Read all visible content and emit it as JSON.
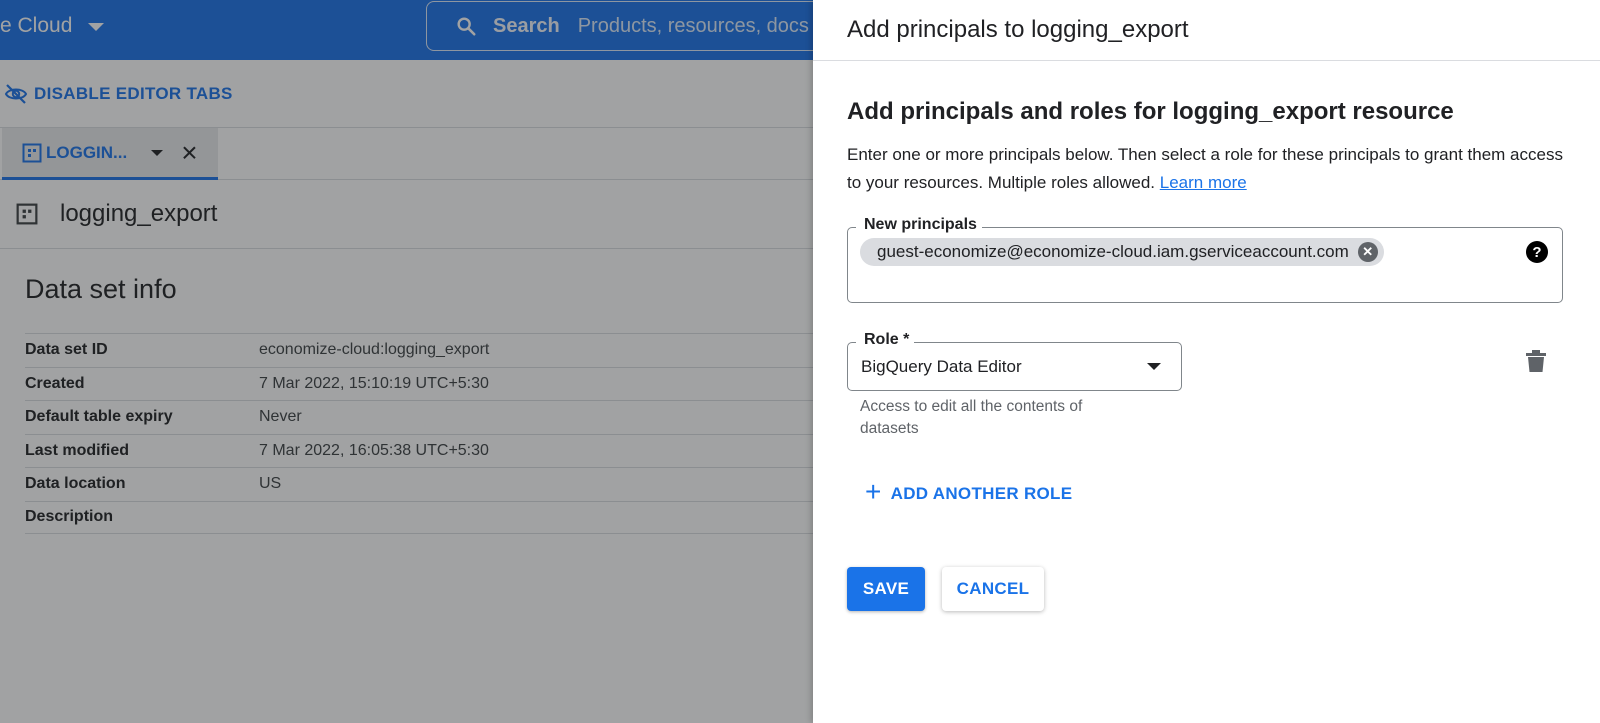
{
  "colors": {
    "brand_blue": "#1a73e8",
    "text": "#202124",
    "muted": "#5f6368"
  },
  "topbar": {
    "brand": "e Cloud",
    "search_label": "Search",
    "search_placeholder": "Products, resources, docs"
  },
  "toolbar": {
    "disable_tabs_label": "DISABLE EDITOR TABS"
  },
  "tab": {
    "label": "LOGGIN..."
  },
  "resource": {
    "title": "logging_export"
  },
  "dataset_info": {
    "title": "Data set info",
    "rows": [
      {
        "key": "Data set ID",
        "value": "economize-cloud:logging_export"
      },
      {
        "key": "Created",
        "value": "7 Mar 2022, 15:10:19 UTC+5:30"
      },
      {
        "key": "Default table expiry",
        "value": "Never"
      },
      {
        "key": "Last modified",
        "value": "7 Mar 2022, 16:05:38 UTC+5:30"
      },
      {
        "key": "Data location",
        "value": "US"
      },
      {
        "key": "Description",
        "value": ""
      }
    ]
  },
  "panel": {
    "title": "Add principals to logging_export",
    "section_title": "Add principals and roles for logging_export resource",
    "description": "Enter one or more principals below. Then select a role for these principals to grant them access to your resources. Multiple roles allowed.",
    "learn_more": "Learn more",
    "principals_label": "New principals",
    "principal_chip": "guest-economize@economize-cloud.iam.gserviceaccount.com",
    "help_glyph": "?",
    "role_label": "Role *",
    "role_value": "BigQuery Data Editor",
    "role_hint": "Access to edit all the contents of datasets",
    "add_role": "ADD ANOTHER ROLE",
    "save": "SAVE",
    "cancel": "CANCEL"
  }
}
